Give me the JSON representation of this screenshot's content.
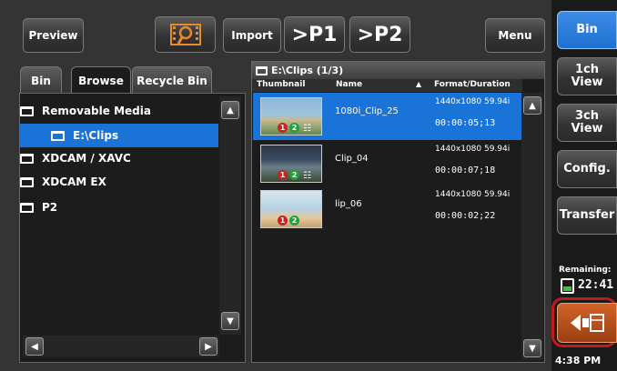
{
  "toolbar": {
    "preview_label": "Preview",
    "search_icon": "search-film-icon",
    "import_label": "Import",
    "p1_label": ">P1",
    "p2_label": ">P2",
    "menu_label": "Menu"
  },
  "tabs": [
    "Bin",
    "Browse",
    "Recycle Bin"
  ],
  "active_tab": "Browse",
  "tree": {
    "items": [
      {
        "label": "Removable Media",
        "level": 0,
        "selected": false
      },
      {
        "label": "E:\\Clips",
        "level": 1,
        "selected": true
      },
      {
        "label": "XDCAM / XAVC",
        "level": 0,
        "selected": false
      },
      {
        "label": "XDCAM EX",
        "level": 0,
        "selected": false
      },
      {
        "label": "P2",
        "level": 0,
        "selected": false
      }
    ]
  },
  "clip_list": {
    "path_title": "E:\\Clips (1/3)",
    "columns": {
      "thumbnail": "Thumbnail",
      "name": "Name",
      "format": "Format/Duration"
    },
    "sort_icon": "sort-up-icon",
    "clips": [
      {
        "name": "1080i_Clip_25",
        "format": "1440x1080 59.94i",
        "duration": "00:00:05;13",
        "selected": true
      },
      {
        "name": "Clip_04",
        "format": "1440x1080 59.94i",
        "duration": "00:00:07;18",
        "selected": false
      },
      {
        "name": "lip_06",
        "format": "1440x1080 59.94i",
        "duration": "00:00:02;22",
        "selected": false
      }
    ],
    "badges": [
      "1",
      "2"
    ]
  },
  "side": {
    "bin_label": "Bin",
    "view1_label": "1ch View",
    "view3_label": "3ch View",
    "config_label": "Config.",
    "transfer_label": "Transfer",
    "remaining_label": "Remaining:",
    "remaining_value": "22:41",
    "back_icon": "eject-back-icon",
    "time": "4:38 PM"
  },
  "colors": {
    "selection": "#1a74d8",
    "accent_orange": "#c8521a",
    "bin_active": "#1f72d4"
  }
}
